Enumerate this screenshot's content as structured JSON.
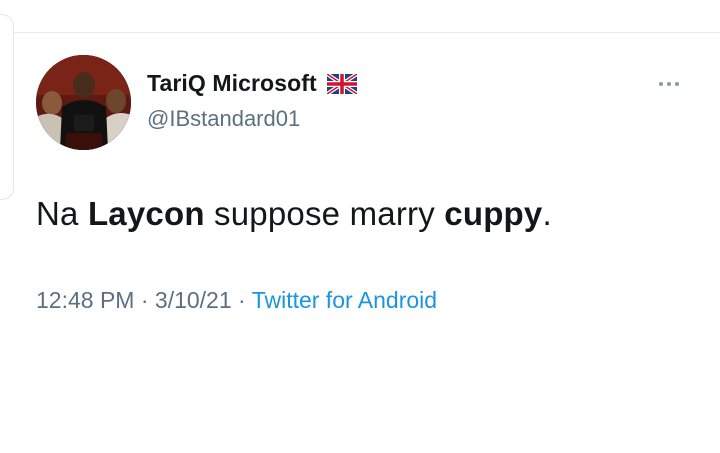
{
  "tweet": {
    "author": {
      "display_name": "TariQ Microsoft",
      "handle": "@IBstandard01",
      "flag_icon": "uk-flag-icon"
    },
    "text_parts": [
      {
        "text": "Na ",
        "bold": false
      },
      {
        "text": "Laycon",
        "bold": true
      },
      {
        "text": " suppose marry ",
        "bold": false
      },
      {
        "text": "cuppy",
        "bold": true
      },
      {
        "text": ".",
        "bold": false
      }
    ],
    "time": "12:48 PM",
    "separator": " · ",
    "date": "3/10/21",
    "source": "Twitter for Android",
    "more_icon": "more-options-icon"
  },
  "colors": {
    "text": "#14171a",
    "muted": "#5b7083",
    "link": "#1b95e0",
    "divider": "#e6ecf0"
  }
}
